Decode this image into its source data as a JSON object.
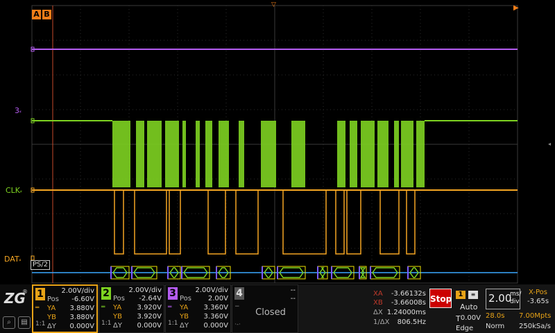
{
  "header": {
    "cursor_a": "A",
    "cursor_b": "B"
  },
  "waveform": {
    "colors": {
      "purple": "#b45cf0",
      "green": "#7ed321",
      "orange": "#f5a623",
      "bus": "#3aa7ff",
      "grid": "#2c2c2c",
      "border": "#3a3a3a",
      "cursor": "#c74a2a"
    },
    "labels": {
      "ch3": "3",
      "clk": "CLK",
      "dat": "DAT"
    },
    "bus_name": "PS/2"
  },
  "channels": [
    {
      "num": "1",
      "color": "#e8a317",
      "scale": "2.00V/div",
      "pos_label": "Pos",
      "pos": "-6.60V",
      "ya_label": "YA",
      "ya": "3.880V",
      "yb_label": "YB",
      "yb": "3.880V",
      "dy_label": "ΔY",
      "dy": "0.000V",
      "coupling": "1:1",
      "selected": true
    },
    {
      "num": "2",
      "color": "#7ed321",
      "scale": "2.00V/div",
      "pos_label": "Pos",
      "pos": "-2.64V",
      "ya_label": "YA",
      "ya": "3.920V",
      "yb_label": "YB",
      "yb": "3.920V",
      "dy_label": "ΔY",
      "dy": "0.000V",
      "coupling": "1:1",
      "selected": false
    },
    {
      "num": "3",
      "color": "#b45cf0",
      "scale": "2.00V/div",
      "pos_label": "Pos",
      "pos": "2.00V",
      "ya_label": "YA",
      "ya": "3.360V",
      "yb_label": "YB",
      "yb": "3.360V",
      "dy_label": "ΔY",
      "dy": "0.000V",
      "coupling": "1:1",
      "selected": false
    },
    {
      "num": "4",
      "color": "#666666",
      "scale": "--",
      "pos_label": "",
      "pos": "--",
      "state": "Closed"
    }
  ],
  "cursors": {
    "xa_label": "XA",
    "xa": "-3.66132s",
    "xb_label": "XB",
    "xb": "-3.66008s",
    "dx_label": "ΔX",
    "dx": "1.24000ms",
    "inv_label": "1/ΔX",
    "inv": "806.5Hz"
  },
  "run": {
    "stop_label": "Stop"
  },
  "trigger": {
    "source": "1",
    "mode": "Auto",
    "type_label": "T",
    "level": "0.00V",
    "edge": "Edge"
  },
  "timebase": {
    "scale": "2.00",
    "unit_top": "ms/",
    "unit_bot": "div",
    "xpos_label": "X-Pos",
    "xpos": "-3.65s",
    "time": "28.0s",
    "mpts": "7.00Mpts",
    "mode": "Norm",
    "rate": "250kSa/s"
  }
}
